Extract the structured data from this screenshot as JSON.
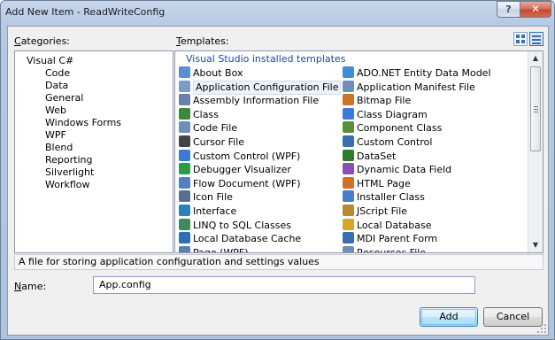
{
  "window": {
    "title": "Add New Item - ReadWriteConfig",
    "help_label": "?",
    "close_label": "✕"
  },
  "categories": {
    "label_accel": "C",
    "label_rest": "ategories:",
    "root": "Visual C#",
    "items": [
      "Code",
      "Data",
      "General",
      "Web",
      "Windows Forms",
      "WPF",
      "Blend",
      "Reporting",
      "Silverlight",
      "Workflow"
    ]
  },
  "templates": {
    "label_accel": "T",
    "label_rest": "emplates:",
    "group_header": "Visual Studio installed templates",
    "left_column": [
      {
        "label": "About Box",
        "icon": "about-box-icon",
        "color": "#5b8fd1"
      },
      {
        "label": "Application Configuration File",
        "icon": "config-file-icon",
        "color": "#7a9cc6",
        "selected": true
      },
      {
        "label": "Assembly Information File",
        "icon": "assembly-info-icon",
        "color": "#6c7fa8"
      },
      {
        "label": "Class",
        "icon": "class-icon",
        "color": "#3a8a3a"
      },
      {
        "label": "Code File",
        "icon": "code-file-icon",
        "color": "#6f8fb9"
      },
      {
        "label": "Cursor File",
        "icon": "cursor-file-icon",
        "color": "#444444"
      },
      {
        "label": "Custom Control (WPF)",
        "icon": "custom-control-wpf-icon",
        "color": "#3a7bd5"
      },
      {
        "label": "Debugger Visualizer",
        "icon": "debugger-visualizer-icon",
        "color": "#2f9a4c"
      },
      {
        "label": "Flow Document (WPF)",
        "icon": "flow-document-icon",
        "color": "#4f7fc4"
      },
      {
        "label": "Icon File",
        "icon": "icon-file-icon",
        "color": "#5a6f8c"
      },
      {
        "label": "Interface",
        "icon": "interface-icon",
        "color": "#2c7fb8"
      },
      {
        "label": "LINQ to SQL Classes",
        "icon": "linq-to-sql-icon",
        "color": "#3d8a5a"
      },
      {
        "label": "Local Database Cache",
        "icon": "local-database-cache-icon",
        "color": "#2e6fb0"
      },
      {
        "label": "Page (WPF)",
        "icon": "page-wpf-icon",
        "color": "#5a7fb2"
      }
    ],
    "right_column": [
      {
        "label": "ADO.NET Entity Data Model",
        "icon": "entity-data-model-icon",
        "color": "#3f8fd2"
      },
      {
        "label": "Application Manifest File",
        "icon": "manifest-file-icon",
        "color": "#6f8fb9"
      },
      {
        "label": "Bitmap File",
        "icon": "bitmap-file-icon",
        "color": "#c9732b"
      },
      {
        "label": "Class Diagram",
        "icon": "class-diagram-icon",
        "color": "#3a7bd5"
      },
      {
        "label": "Component Class",
        "icon": "component-class-icon",
        "color": "#5a8f3a"
      },
      {
        "label": "Custom Control",
        "icon": "custom-control-icon",
        "color": "#3a6fb0"
      },
      {
        "label": "DataSet",
        "icon": "dataset-icon",
        "color": "#2e7d32"
      },
      {
        "label": "Dynamic Data Field",
        "icon": "dynamic-data-field-icon",
        "color": "#8a4fb5"
      },
      {
        "label": "HTML Page",
        "icon": "html-page-icon",
        "color": "#d0702a"
      },
      {
        "label": "Installer Class",
        "icon": "installer-class-icon",
        "color": "#4a7fc4"
      },
      {
        "label": "JScript File",
        "icon": "jscript-file-icon",
        "color": "#b88a2c"
      },
      {
        "label": "Local Database",
        "icon": "local-database-icon",
        "color": "#d4a62a"
      },
      {
        "label": "MDI Parent Form",
        "icon": "mdi-parent-form-icon",
        "color": "#3a6fb0"
      },
      {
        "label": "Resources File",
        "icon": "resources-file-icon",
        "color": "#6f8fb9"
      }
    ]
  },
  "description": "A file for storing application configuration and settings values",
  "name_field": {
    "label_accel": "N",
    "label_rest": "ame:",
    "value": "App.config"
  },
  "buttons": {
    "add": "Add",
    "cancel": "Cancel"
  }
}
